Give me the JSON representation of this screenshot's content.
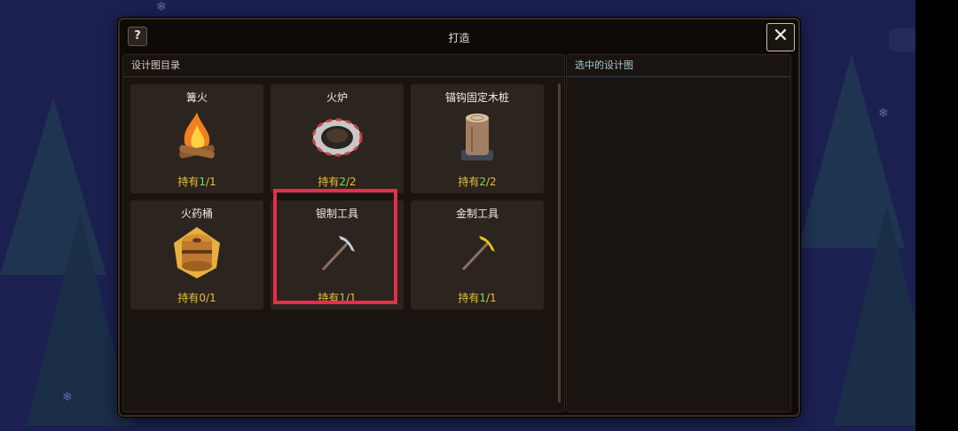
{
  "dialog": {
    "help_label": "?",
    "title": "打造",
    "close_label": "✕"
  },
  "left_panel": {
    "header": "设计图目录"
  },
  "right_panel": {
    "header": "选中的设计图"
  },
  "owned_prefix": "持有",
  "recipes": [
    {
      "name": "篝火",
      "owned": "1",
      "total": "1",
      "icon": "campfire-icon"
    },
    {
      "name": "火炉",
      "owned": "2",
      "total": "2",
      "icon": "furnace-icon"
    },
    {
      "name": "锚钩固定木桩",
      "owned": "2",
      "total": "2",
      "icon": "anchor-stake-icon"
    },
    {
      "name": "火药桶",
      "owned": "0",
      "total": "1",
      "icon": "powder-keg-icon"
    },
    {
      "name": "银制工具",
      "owned": "1",
      "total": "1",
      "icon": "silver-pickaxe-icon"
    },
    {
      "name": "金制工具",
      "owned": "1",
      "total": "1",
      "icon": "gold-pickaxe-icon"
    }
  ],
  "colors": {
    "accent_highlight": "#e0304a",
    "owned_label": "#e8c040",
    "owned_count": "#70e060"
  }
}
